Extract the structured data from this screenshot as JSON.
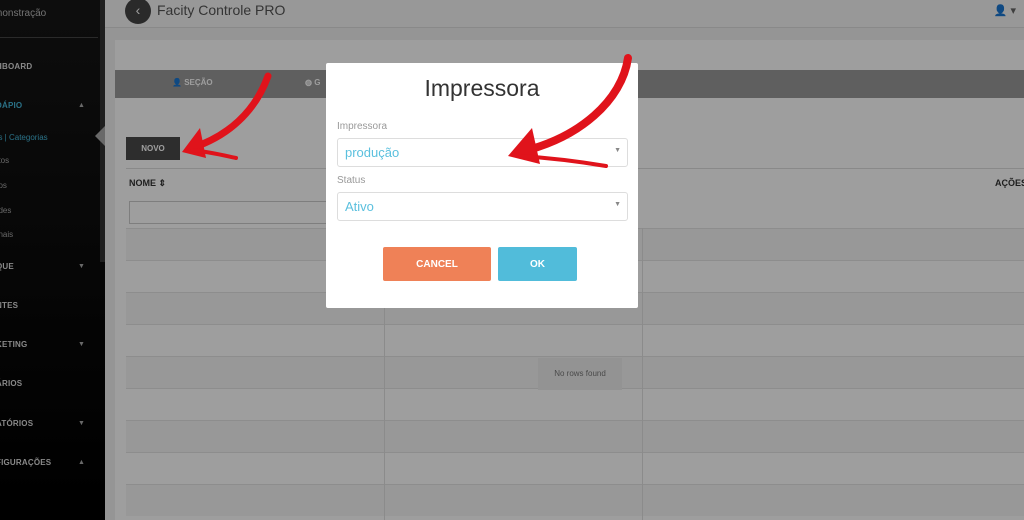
{
  "header": {
    "back_icon": "chevron-left-icon",
    "title": "Facity Controle PRO",
    "user_icon": "user-icon"
  },
  "sidebar": {
    "account": "monstração",
    "items": [
      {
        "label": "HBOARD"
      },
      {
        "label": "DÁPIO",
        "active": true
      },
      {
        "label": "QUE"
      },
      {
        "label": "NTES"
      },
      {
        "label": "KETING"
      },
      {
        "label": "ÁRIOS"
      },
      {
        "label": "ATÓRIOS"
      },
      {
        "label": "FIGURAÇÕES"
      }
    ],
    "subitems": [
      {
        "label": "es | Categorias",
        "active": true
      },
      {
        "label": "utos"
      },
      {
        "label": "pos"
      },
      {
        "label": "ades"
      },
      {
        "label": "onais"
      }
    ]
  },
  "tabs": [
    {
      "label": "SEÇÃO",
      "icon": "user-icon"
    },
    {
      "label": "G",
      "icon": "globe-icon"
    }
  ],
  "toolbar": {
    "new_label": "NOVO"
  },
  "table": {
    "columns": [
      {
        "label": "NOME",
        "sort_icon": "sort-icon"
      },
      {
        "label": "AÇÕES"
      }
    ],
    "empty_text": "No rows found"
  },
  "modal": {
    "title": "Impressora",
    "fields": [
      {
        "label": "Impressora",
        "value": "produção"
      },
      {
        "label": "Status",
        "value": "Ativo"
      }
    ],
    "cancel_label": "CANCEL",
    "ok_label": "OK"
  },
  "colors": {
    "accent": "#51bcda",
    "cancel": "#ef8157",
    "annotation": "#e0131b"
  }
}
